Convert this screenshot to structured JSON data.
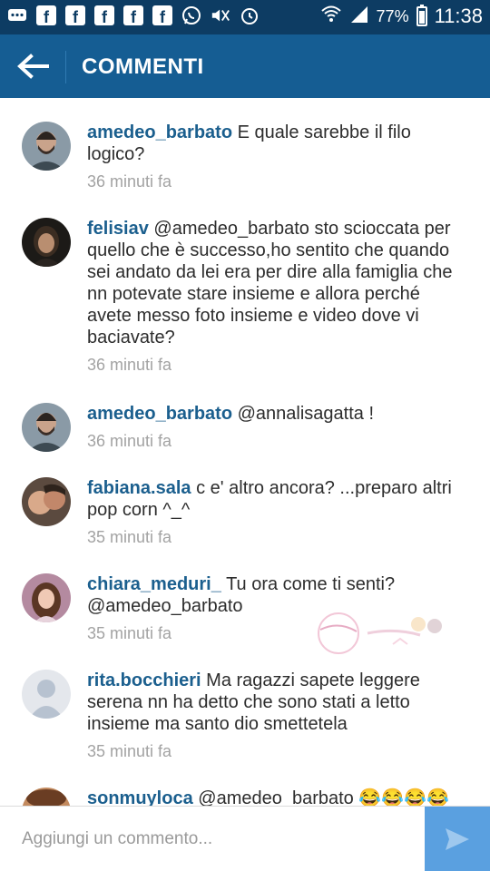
{
  "status_bar": {
    "icons": [
      "messages-icon",
      "facebook-icon",
      "facebook-icon",
      "facebook-icon",
      "facebook-icon",
      "facebook-icon",
      "whatsapp-icon",
      "mute-icon",
      "alarm-icon",
      "wifi-icon",
      "signal-icon"
    ],
    "battery_percent": "77%",
    "battery_level": 0.77,
    "time": "11:38"
  },
  "app_bar": {
    "title": "COMMENTI",
    "back_icon": "arrow-left-icon"
  },
  "comments": [
    {
      "username": "amedeo_barbato",
      "text": "E quale sarebbe il filo logico?",
      "time": "36 minuti fa",
      "avatar": "avatar-man-beard"
    },
    {
      "username": "felisiav",
      "text": "@amedeo_barbato sto sciocсata per quello che è successo,ho sentito che quando sei andato da lei era per dire alla famiglia che nn potevate stare insieme e allora perché avete messo foto insieme e video dove vi baciavate?",
      "time": "36 minuti fa",
      "avatar": "avatar-woman-dark"
    },
    {
      "username": "amedeo_barbato",
      "text": "@annalisagatta !",
      "time": "36 minuti fa",
      "avatar": "avatar-man-beard"
    },
    {
      "username": "fabiana.sala",
      "text": "c e' altro ancora? ...preparo altri pop corn ^_^",
      "time": "35 minuti fa",
      "avatar": "avatar-couple"
    },
    {
      "username": "chiara_meduri_",
      "text": "Tu ora come ti senti? @amedeo_barbato",
      "time": "35 minuti fa",
      "avatar": "avatar-woman-light"
    },
    {
      "username": "rita.bocchieri",
      "text": "Ma ragazzi sapete leggere serena nn ha detto che sono stati a letto insieme ma santo dio smettetela",
      "time": "35 minuti fa",
      "avatar": "avatar-default"
    },
    {
      "username": "sonmuyloca",
      "text": "@amedeo_barbato 😂😂😂😂",
      "time": "",
      "avatar": "avatar-woman-hat"
    }
  ],
  "footer": {
    "placeholder": "Aggiungi un commento...",
    "send_icon": "send-icon"
  },
  "watermark": "watermark-logo"
}
